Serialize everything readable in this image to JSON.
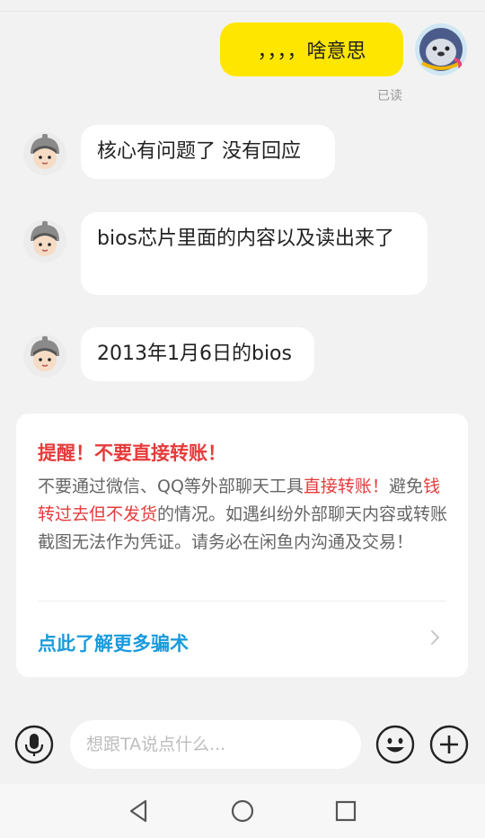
{
  "chat": {
    "my_message": "，，，，啥意思",
    "read_status": "已读",
    "messages": [
      {
        "text": "核心有问题了 没有回应"
      },
      {
        "text": "bios芯片里面的内容以及读出来了"
      },
      {
        "text": "2013年1月6日的bios"
      }
    ]
  },
  "warning": {
    "title": "提醒！不要直接转账！",
    "body_1": "不要通过微信、QQ等外部聊天工具",
    "body_red_1": "直接转账！",
    "body_2": "避免",
    "body_red_2": "钱转过去但不发货",
    "body_3": "的情况。如遇纠纷外部聊天内容或转账截图无法作为凭证。请务必在闲鱼内沟通及交易！",
    "link_text": "点此了解更多骗术"
  },
  "input": {
    "placeholder": "想跟TA说点什么..."
  },
  "icons": {
    "mic": "microphone-icon",
    "emoji": "emoji-icon",
    "plus": "plus-icon",
    "back": "back-triangle-icon",
    "home": "home-circle-icon",
    "recent": "recent-square-icon"
  },
  "colors": {
    "my_bubble": "#ffe600",
    "warning_red": "#e63b3b",
    "link_blue": "#1a9bdc"
  }
}
